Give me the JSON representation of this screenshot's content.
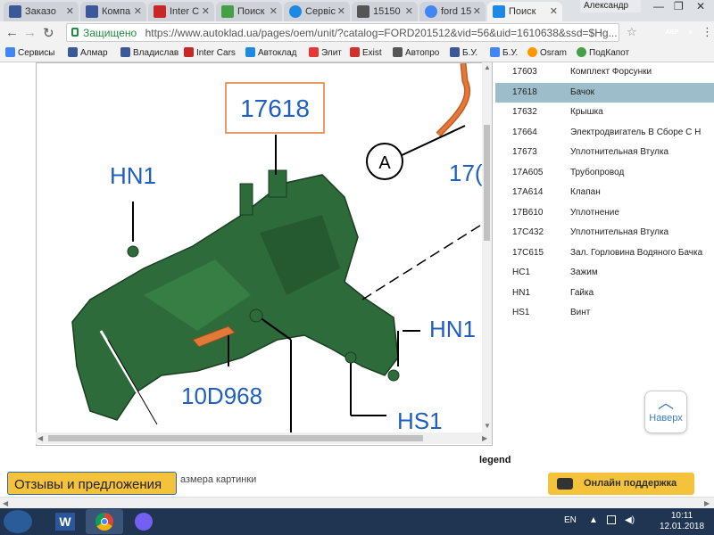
{
  "browser": {
    "tabs": [
      {
        "title": "Заказо",
        "active": false
      },
      {
        "title": "Компа",
        "active": false
      },
      {
        "title": "Inter C",
        "active": false
      },
      {
        "title": "Поиск",
        "active": false
      },
      {
        "title": "Сервіс",
        "active": false
      },
      {
        "title": "15150",
        "active": false
      },
      {
        "title": "ford 15",
        "active": false
      },
      {
        "title": "Поиск",
        "active": true
      }
    ],
    "profile_name": "Александр",
    "address": {
      "secure_label": "Защищено",
      "url": "https://www.autoklad.ua/pages/oem/unit/?catalog=FORD201512&vid=56&uid=1610638&ssd=$Hg..."
    },
    "extensions": [
      {
        "label": "",
        "color": "#d93025"
      },
      {
        "label": "ABP",
        "color": "#c62828"
      },
      {
        "label": "e",
        "color": "#5f6368"
      }
    ],
    "bookmarks": [
      {
        "label": "Сервисы",
        "color": "#4285f4"
      },
      {
        "label": "Алмар",
        "color": "#3b5998"
      },
      {
        "label": "Владислав",
        "color": "#3b5998"
      },
      {
        "label": "Inter Cars",
        "color": "#c62828"
      },
      {
        "label": "Автоклад",
        "color": "#1e88e5"
      },
      {
        "label": "Элит",
        "color": "#e53935"
      },
      {
        "label": "Exist",
        "color": "#d32f2f"
      },
      {
        "label": "Автопро",
        "color": "#555555"
      },
      {
        "label": "Б.У.",
        "color": "#3b5998"
      },
      {
        "label": "Б.У.",
        "color": "#4285f4"
      },
      {
        "label": "Osram",
        "color": "#ff9800"
      },
      {
        "label": "ПодКапот",
        "color": "#43a047"
      }
    ]
  },
  "diagram": {
    "labels": {
      "part_17618": "17618",
      "hn1_left": "HN1",
      "hn1_right": "HN1",
      "hs1": "HS1",
      "part_10d968": "10D968",
      "callout_a": "A",
      "part_cut": "17("
    },
    "colors": {
      "part": "#2e6b3a",
      "accent": "#e07a3a",
      "label": "#1f5fbf",
      "box": "#e07a3a"
    }
  },
  "parts": [
    {
      "code": "17603",
      "name": "Комплект Форсунки",
      "selected": false
    },
    {
      "code": "17618",
      "name": "Бачок",
      "selected": true
    },
    {
      "code": "17632",
      "name": "Крышка",
      "selected": false
    },
    {
      "code": "17664",
      "name": "Электродвигатель В Сборе С Н",
      "selected": false
    },
    {
      "code": "17673",
      "name": "Уплотнительная Втулка",
      "selected": false
    },
    {
      "code": "17A605",
      "name": "Трубопровод",
      "selected": false
    },
    {
      "code": "17A614",
      "name": "Клапан",
      "selected": false
    },
    {
      "code": "17B610",
      "name": "Уплотнение",
      "selected": false
    },
    {
      "code": "17C432",
      "name": "Уплотнительная Втулка",
      "selected": false
    },
    {
      "code": "17C615",
      "name": "Зал. Горловина Водяного Бачка",
      "selected": false
    },
    {
      "code": "HC1",
      "name": "Зажим",
      "selected": false
    },
    {
      "code": "HN1",
      "name": "Гайка",
      "selected": false
    },
    {
      "code": "HS1",
      "name": "Винт",
      "selected": false
    }
  ],
  "page": {
    "back_button_label": "Наверх",
    "legend": "legend",
    "resize_text": "азмера картинки",
    "feedback_label": "Отзывы и предложения",
    "support_label": "Онлайн поддержка"
  },
  "taskbar": {
    "apps": [
      {
        "name": "word",
        "color": "#2b579a",
        "label": "W"
      },
      {
        "name": "chrome",
        "color": "#ffffff",
        "label": ""
      },
      {
        "name": "viber",
        "color": "#7360f2",
        "label": ""
      }
    ],
    "language": "EN",
    "time": "10:11",
    "date": "12.01.2018"
  }
}
